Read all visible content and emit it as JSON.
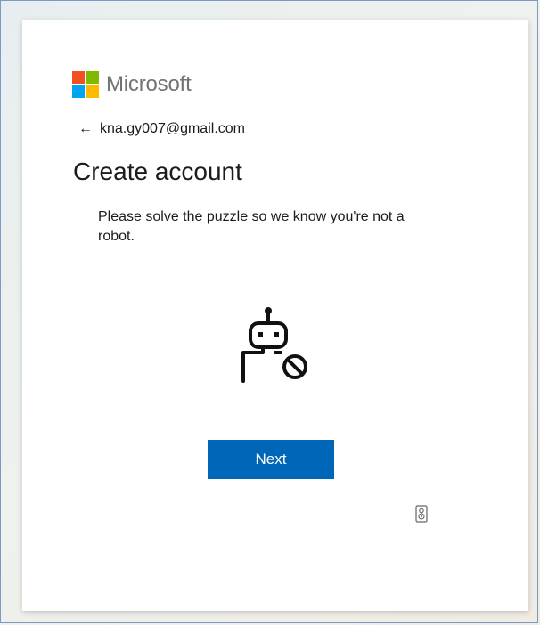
{
  "brand": {
    "name": "Microsoft",
    "logo_colors": [
      "#f25022",
      "#7fba00",
      "#00a4ef",
      "#ffb900"
    ]
  },
  "identity": {
    "arrow": "←",
    "email": "kna.gy007@gmail.com"
  },
  "title": "Create account",
  "description": "Please solve the puzzle so we know you're not a robot.",
  "illustration": {
    "icon": "robot-blocked-icon"
  },
  "actions": {
    "next_label": "Next"
  },
  "audio": {
    "icon": "audio-challenge-icon"
  },
  "colors": {
    "primary_button": "#0067b8",
    "text": "#1b1b1b",
    "brand_text": "#737373"
  }
}
